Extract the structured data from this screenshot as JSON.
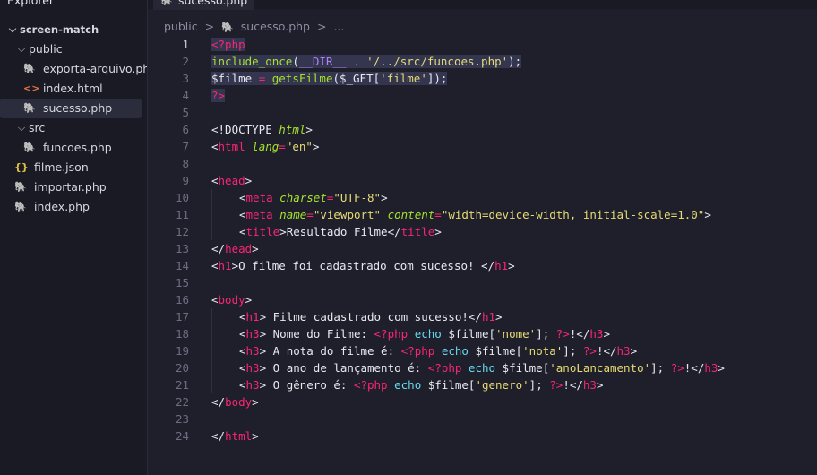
{
  "explorer": {
    "title": "Explorer",
    "more": "···",
    "tree": [
      {
        "label": "screen-match",
        "type": "folder-root",
        "depth": 0
      },
      {
        "label": "public",
        "type": "folder",
        "depth": 1
      },
      {
        "label": "exporta-arquivo.php",
        "type": "php",
        "depth": 2
      },
      {
        "label": "index.html",
        "type": "html",
        "depth": 2
      },
      {
        "label": "sucesso.php",
        "type": "php",
        "depth": 2,
        "selected": true
      },
      {
        "label": "src",
        "type": "folder",
        "depth": 1
      },
      {
        "label": "funcoes.php",
        "type": "php",
        "depth": 2
      },
      {
        "label": "filme.json",
        "type": "json",
        "depth": 1
      },
      {
        "label": "importar.php",
        "type": "php",
        "depth": 1
      },
      {
        "label": "index.php",
        "type": "php",
        "depth": 1
      }
    ]
  },
  "tab": {
    "label": "sucesso.php"
  },
  "breadcrumb": {
    "folder": "public",
    "sep": ">",
    "file": "sucesso.php",
    "more": "..."
  },
  "icons": {
    "php": "elephant-icon",
    "html": "html-icon",
    "json": "json-icon",
    "chevron": "chevron-down-icon"
  },
  "colors": {
    "keyword": "#f92672",
    "function": "#a6e22e",
    "string": "#e6db74",
    "constant": "#ae81ff",
    "builtin": "#66d9ef"
  },
  "code": {
    "line_numbers": [
      "1",
      "2",
      "3",
      "4",
      "5",
      "6",
      "7",
      "8",
      "9",
      "10",
      "11",
      "12",
      "13",
      "14",
      "15",
      "16",
      "17",
      "18",
      "19",
      "20",
      "21",
      "22",
      "23",
      "24"
    ],
    "lines": [
      {
        "hl": true,
        "indent": 0,
        "tokens": [
          [
            "php",
            "<?php"
          ]
        ]
      },
      {
        "hl": true,
        "indent": 0,
        "tokens": [
          [
            "fn",
            "include_once"
          ],
          [
            "txt",
            "("
          ],
          [
            "const",
            "__DIR__"
          ],
          [
            "dim",
            " . "
          ],
          [
            "str",
            "'/../src/funcoes.php'"
          ],
          [
            "txt",
            ");"
          ]
        ]
      },
      {
        "hl": true,
        "indent": 0,
        "tokens": [
          [
            "txt",
            "$filme "
          ],
          [
            "op",
            "="
          ],
          [
            "txt",
            " "
          ],
          [
            "fn",
            "getsFilme"
          ],
          [
            "txt",
            "($_GET["
          ],
          [
            "str",
            "'filme'"
          ],
          [
            "txt",
            "]);"
          ]
        ]
      },
      {
        "hl": true,
        "indent": 0,
        "tokens": [
          [
            "php",
            "?>"
          ]
        ]
      },
      {
        "hl": false,
        "indent": 0,
        "tokens": []
      },
      {
        "hl": false,
        "indent": 0,
        "tokens": [
          [
            "txt",
            "<!DOCTYPE "
          ],
          [
            "attr",
            "html"
          ],
          [
            "txt",
            ">"
          ]
        ]
      },
      {
        "hl": false,
        "indent": 0,
        "tokens": [
          [
            "txt",
            "<"
          ],
          [
            "tag",
            "html"
          ],
          [
            "txt",
            " "
          ],
          [
            "attr",
            "lang"
          ],
          [
            "op",
            "="
          ],
          [
            "str",
            "\"en\""
          ],
          [
            "txt",
            ">"
          ]
        ]
      },
      {
        "hl": false,
        "indent": 0,
        "tokens": []
      },
      {
        "hl": false,
        "indent": 0,
        "tokens": [
          [
            "txt",
            "<"
          ],
          [
            "tag",
            "head"
          ],
          [
            "txt",
            ">"
          ]
        ]
      },
      {
        "hl": false,
        "indent": 1,
        "tokens": [
          [
            "txt",
            "<"
          ],
          [
            "tag",
            "meta"
          ],
          [
            "txt",
            " "
          ],
          [
            "attr",
            "charset"
          ],
          [
            "op",
            "="
          ],
          [
            "str",
            "\"UTF-8\""
          ],
          [
            "txt",
            ">"
          ]
        ]
      },
      {
        "hl": false,
        "indent": 1,
        "tokens": [
          [
            "txt",
            "<"
          ],
          [
            "tag",
            "meta"
          ],
          [
            "txt",
            " "
          ],
          [
            "attr",
            "name"
          ],
          [
            "op",
            "="
          ],
          [
            "str",
            "\"viewport\""
          ],
          [
            "txt",
            " "
          ],
          [
            "attr",
            "content"
          ],
          [
            "op",
            "="
          ],
          [
            "str",
            "\"width=device-width, initial-scale=1.0\""
          ],
          [
            "txt",
            ">"
          ]
        ]
      },
      {
        "hl": false,
        "indent": 1,
        "tokens": [
          [
            "txt",
            "<"
          ],
          [
            "tag",
            "title"
          ],
          [
            "txt",
            ">Resultado Filme</"
          ],
          [
            "tag",
            "title"
          ],
          [
            "txt",
            ">"
          ]
        ]
      },
      {
        "hl": false,
        "indent": 0,
        "tokens": [
          [
            "txt",
            "</"
          ],
          [
            "tag",
            "head"
          ],
          [
            "txt",
            ">"
          ]
        ]
      },
      {
        "hl": false,
        "indent": 0,
        "tokens": [
          [
            "txt",
            "<"
          ],
          [
            "tag",
            "h1"
          ],
          [
            "txt",
            ">O filme foi cadastrado com sucesso! </"
          ],
          [
            "tag",
            "h1"
          ],
          [
            "txt",
            ">"
          ]
        ]
      },
      {
        "hl": false,
        "indent": 0,
        "tokens": []
      },
      {
        "hl": false,
        "indent": 0,
        "tokens": [
          [
            "txt",
            "<"
          ],
          [
            "tag",
            "body"
          ],
          [
            "txt",
            ">"
          ]
        ]
      },
      {
        "hl": false,
        "indent": 1,
        "tokens": [
          [
            "txt",
            "<"
          ],
          [
            "tag",
            "h1"
          ],
          [
            "txt",
            "> Filme cadastrado com sucesso!</"
          ],
          [
            "tag",
            "h1"
          ],
          [
            "txt",
            ">"
          ]
        ]
      },
      {
        "hl": false,
        "indent": 1,
        "tokens": [
          [
            "txt",
            "<"
          ],
          [
            "tag",
            "h3"
          ],
          [
            "txt",
            "> Nome do Filme: "
          ],
          [
            "php",
            "<?php"
          ],
          [
            "txt",
            " "
          ],
          [
            "kw",
            "echo"
          ],
          [
            "txt",
            " $filme["
          ],
          [
            "str",
            "'nome'"
          ],
          [
            "txt",
            "]; "
          ],
          [
            "php",
            "?>"
          ],
          [
            "txt",
            "!</"
          ],
          [
            "tag",
            "h3"
          ],
          [
            "txt",
            ">"
          ]
        ]
      },
      {
        "hl": false,
        "indent": 1,
        "tokens": [
          [
            "txt",
            "<"
          ],
          [
            "tag",
            "h3"
          ],
          [
            "txt",
            "> A nota do filme é: "
          ],
          [
            "php",
            "<?php"
          ],
          [
            "txt",
            " "
          ],
          [
            "kw",
            "echo"
          ],
          [
            "txt",
            " $filme["
          ],
          [
            "str",
            "'nota'"
          ],
          [
            "txt",
            "]; "
          ],
          [
            "php",
            "?>"
          ],
          [
            "txt",
            "!</"
          ],
          [
            "tag",
            "h3"
          ],
          [
            "txt",
            ">"
          ]
        ]
      },
      {
        "hl": false,
        "indent": 1,
        "tokens": [
          [
            "txt",
            "<"
          ],
          [
            "tag",
            "h3"
          ],
          [
            "txt",
            "> O ano de lançamento é: "
          ],
          [
            "php",
            "<?php"
          ],
          [
            "txt",
            " "
          ],
          [
            "kw",
            "echo"
          ],
          [
            "txt",
            " $filme["
          ],
          [
            "str",
            "'anoLancamento'"
          ],
          [
            "txt",
            "]; "
          ],
          [
            "php",
            "?>"
          ],
          [
            "txt",
            "!</"
          ],
          [
            "tag",
            "h3"
          ],
          [
            "txt",
            ">"
          ]
        ]
      },
      {
        "hl": false,
        "indent": 1,
        "tokens": [
          [
            "txt",
            "<"
          ],
          [
            "tag",
            "h3"
          ],
          [
            "txt",
            "> O gênero é: "
          ],
          [
            "php",
            "<?php"
          ],
          [
            "txt",
            " "
          ],
          [
            "kw",
            "echo"
          ],
          [
            "txt",
            " $filme["
          ],
          [
            "str",
            "'genero'"
          ],
          [
            "txt",
            "]; "
          ],
          [
            "php",
            "?>"
          ],
          [
            "txt",
            "!</"
          ],
          [
            "tag",
            "h3"
          ],
          [
            "txt",
            ">"
          ]
        ]
      },
      {
        "hl": false,
        "indent": 0,
        "tokens": [
          [
            "txt",
            "</"
          ],
          [
            "tag",
            "body"
          ],
          [
            "txt",
            ">"
          ]
        ]
      },
      {
        "hl": false,
        "indent": 0,
        "tokens": []
      },
      {
        "hl": false,
        "indent": 0,
        "tokens": [
          [
            "txt",
            "</"
          ],
          [
            "tag",
            "html"
          ],
          [
            "txt",
            ">"
          ]
        ]
      }
    ]
  }
}
